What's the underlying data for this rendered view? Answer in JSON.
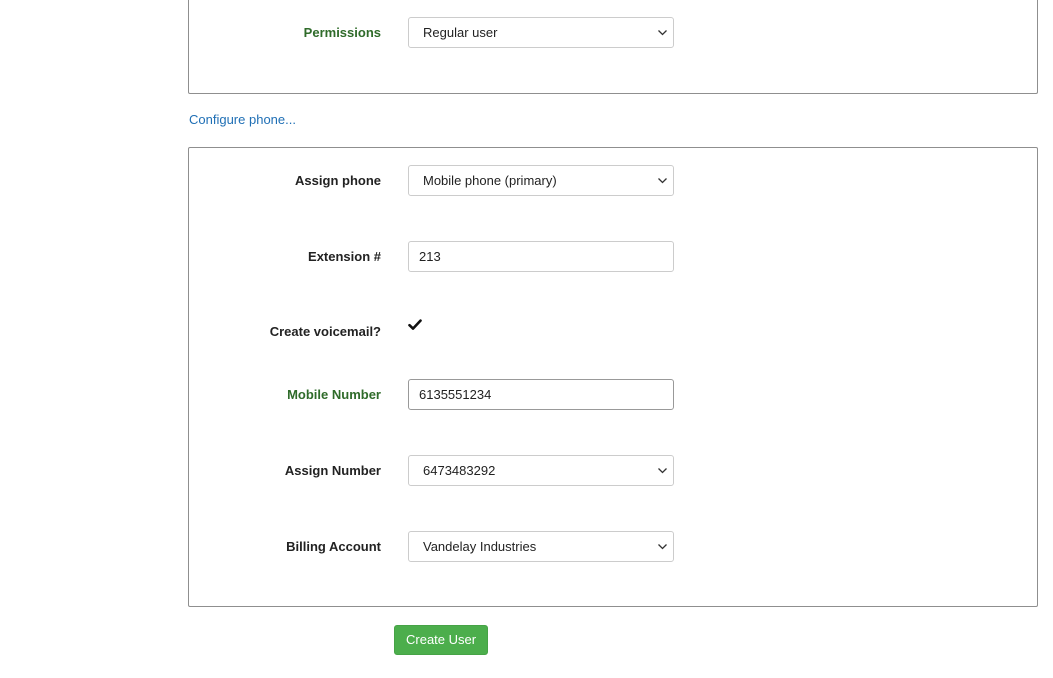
{
  "permissions": {
    "label": "Permissions",
    "value": "Regular user"
  },
  "configure_link": "Configure phone...",
  "phone": {
    "assign_phone": {
      "label": "Assign phone",
      "value": "Mobile phone (primary)"
    },
    "extension": {
      "label": "Extension #",
      "value": "213"
    },
    "voicemail": {
      "label": "Create voicemail?",
      "checked": true
    },
    "mobile_number": {
      "label": "Mobile Number",
      "value": "6135551234"
    },
    "assign_number": {
      "label": "Assign Number",
      "value": "6473483292"
    },
    "billing_account": {
      "label": "Billing Account",
      "value": "Vandelay Industries"
    }
  },
  "create_button": "Create User",
  "colors": {
    "label_green": "#2f6b2a",
    "link_blue": "#1f6fb5",
    "button_green": "#4cae4c"
  },
  "icons": {
    "select_arrow": "chevron-down-icon",
    "checkbox": "checkmark-icon"
  }
}
